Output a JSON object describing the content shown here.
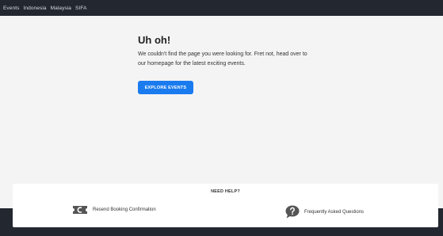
{
  "nav": {
    "items": [
      "Events",
      "Indonesia",
      "Malaysia",
      "SIFA"
    ]
  },
  "error": {
    "title": "Uh oh!",
    "message": "We couldn't find the page you were looking for. Fret not, head over to our homepage for the latest exciting events.",
    "button_label": "EXPLORE EVENTS"
  },
  "help": {
    "title": "NEED HELP?",
    "links": [
      {
        "label": "Resend Booking Confirmation",
        "icon": "ticket-icon"
      },
      {
        "label": "Frequently Asked Questions",
        "icon": "question-bubble-icon"
      }
    ]
  },
  "colors": {
    "nav_bg": "#23272f",
    "accent": "#1a7bef",
    "page_bg": "#f4f4f5"
  }
}
